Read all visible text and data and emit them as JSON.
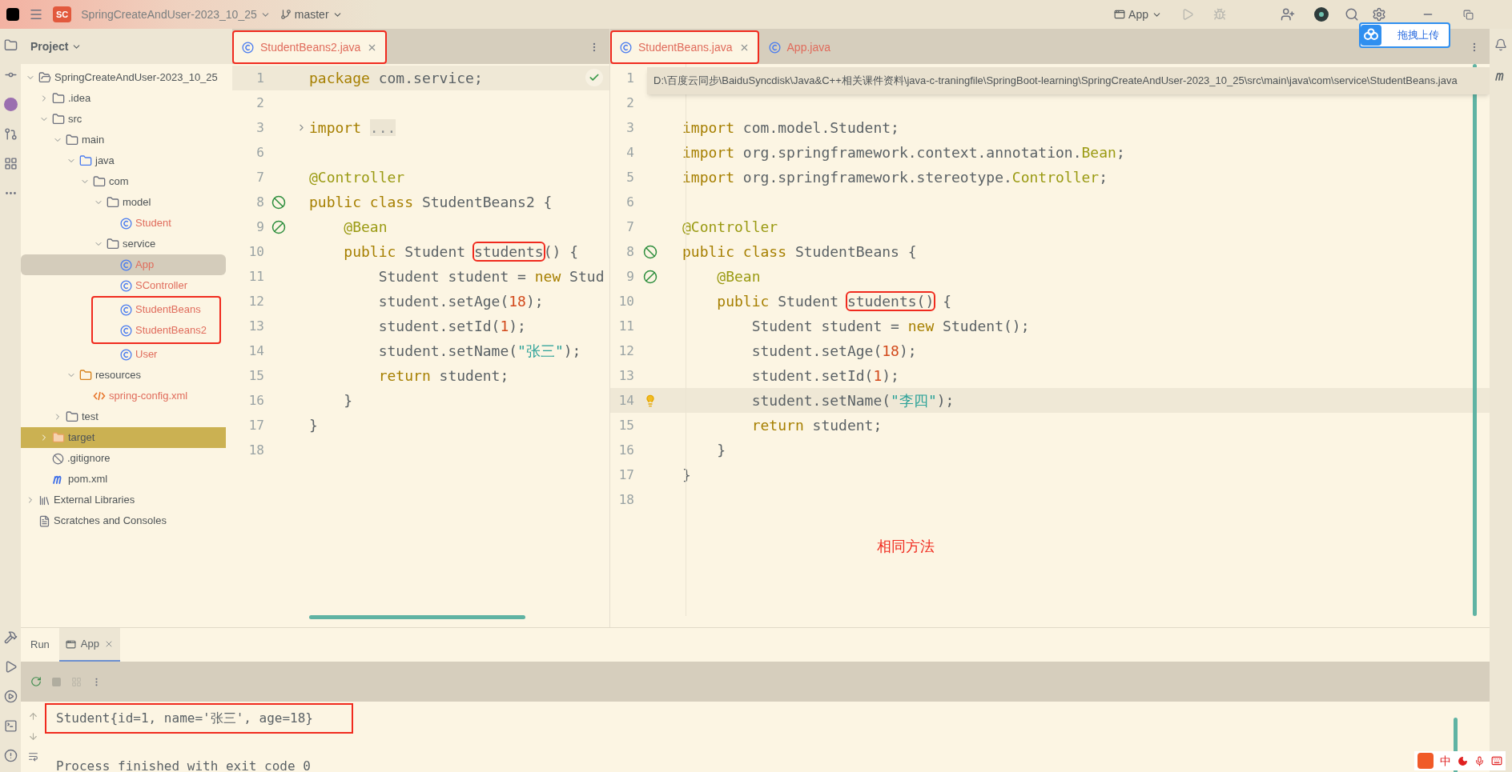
{
  "title_bar": {
    "project_badge": "SC",
    "project": "SpringCreateAndUser-2023_10_25",
    "branch": "master",
    "run_config": "App"
  },
  "upload_button": {
    "label": "拖拽上传"
  },
  "project_panel": {
    "title": "Project",
    "tree": [
      {
        "label": "SpringCreateAndUser-2023_10_25",
        "kind": "module",
        "expanded": true,
        "selected": false,
        "untracked": false,
        "boxed": false,
        "children": [
          {
            "label": ".idea",
            "kind": "folder",
            "expanded": false,
            "selected": false,
            "untracked": false,
            "boxed": false
          },
          {
            "label": "src",
            "kind": "folder",
            "expanded": true,
            "selected": false,
            "untracked": false,
            "boxed": false,
            "children": [
              {
                "label": "main",
                "kind": "folder",
                "expanded": true,
                "selected": false,
                "untracked": false,
                "boxed": false,
                "children": [
                  {
                    "label": "java",
                    "kind": "source",
                    "expanded": true,
                    "selected": false,
                    "untracked": false,
                    "boxed": false,
                    "children": [
                      {
                        "label": "com",
                        "kind": "package",
                        "expanded": true,
                        "selected": false,
                        "untracked": false,
                        "boxed": false,
                        "children": [
                          {
                            "label": "model",
                            "kind": "package",
                            "expanded": true,
                            "selected": false,
                            "untracked": false,
                            "boxed": false,
                            "children": [
                              {
                                "label": "Student",
                                "kind": "class",
                                "selected": false,
                                "untracked": true,
                                "boxed": false
                              }
                            ]
                          },
                          {
                            "label": "service",
                            "kind": "package",
                            "expanded": true,
                            "selected": false,
                            "untracked": false,
                            "boxed": false,
                            "children": [
                              {
                                "label": "App",
                                "kind": "class",
                                "selected": true,
                                "untracked": true,
                                "boxed": false
                              },
                              {
                                "label": "SController",
                                "kind": "class",
                                "selected": false,
                                "untracked": true,
                                "boxed": false
                              },
                              {
                                "label": "StudentBeans",
                                "kind": "class",
                                "selected": false,
                                "untracked": true,
                                "boxed": true
                              },
                              {
                                "label": "StudentBeans2",
                                "kind": "class",
                                "selected": false,
                                "untracked": true,
                                "boxed": true
                              },
                              {
                                "label": "User",
                                "kind": "class",
                                "selected": false,
                                "untracked": true,
                                "boxed": false
                              }
                            ]
                          }
                        ]
                      }
                    ]
                  },
                  {
                    "label": "resources",
                    "kind": "resources",
                    "expanded": true,
                    "selected": false,
                    "untracked": false,
                    "boxed": false,
                    "children": [
                      {
                        "label": "spring-config.xml",
                        "kind": "xml",
                        "selected": false,
                        "untracked": true,
                        "boxed": false
                      }
                    ]
                  }
                ]
              },
              {
                "label": "test",
                "kind": "folder",
                "expanded": false,
                "selected": false,
                "untracked": false,
                "boxed": false
              }
            ]
          },
          {
            "label": "target",
            "kind": "excluded",
            "expanded": false,
            "selected": false,
            "untracked": false,
            "boxed": false
          },
          {
            "label": ".gitignore",
            "kind": "ignore",
            "selected": false,
            "untracked": false,
            "boxed": false
          },
          {
            "label": "pom.xml",
            "kind": "maven",
            "selected": false,
            "untracked": false,
            "boxed": false
          }
        ]
      },
      {
        "label": "External Libraries",
        "kind": "libraries",
        "expanded": false,
        "selected": false,
        "untracked": false,
        "boxed": false
      },
      {
        "label": "Scratches and Consoles",
        "kind": "scratches",
        "selected": false,
        "untracked": false,
        "boxed": false
      }
    ]
  },
  "left_editor": {
    "tabs": [
      {
        "label": "StudentBeans2.java",
        "selected": true,
        "boxed": true
      }
    ],
    "inspection_ok": true,
    "lines": [
      {
        "number": "1",
        "current": true,
        "segments": [
          {
            "kind": "keyword",
            "text": "package"
          },
          {
            "kind": "plain",
            "text": " com.service;"
          }
        ]
      },
      {
        "number": "2",
        "current": false
      },
      {
        "number": "3",
        "current": false,
        "folded": true,
        "segments": [
          {
            "kind": "keyword",
            "text": "import "
          },
          {
            "kind": "fold",
            "text": "..."
          }
        ]
      },
      {
        "number": "6",
        "current": false
      },
      {
        "number": "7",
        "current": false,
        "segments": [
          {
            "kind": "annotation",
            "text": "@Controller"
          }
        ]
      },
      {
        "number": "8",
        "current": false,
        "marker": {
          "kind": "bean-class"
        },
        "segments": [
          {
            "kind": "keyword",
            "text": "public class"
          },
          {
            "kind": "plain",
            "text": " StudentBeans2 {"
          }
        ]
      },
      {
        "number": "9",
        "current": false,
        "marker": {
          "kind": "bean-method"
        },
        "segments": [
          {
            "kind": "annotation",
            "text": "    @Bean"
          }
        ]
      },
      {
        "number": "10",
        "current": false,
        "segments": [
          {
            "kind": "keyword",
            "text": "    public"
          },
          {
            "kind": "plain",
            "text": " Student "
          },
          {
            "kind": "plain",
            "text": "students",
            "boxed": true
          },
          {
            "kind": "plain",
            "text": "() {"
          }
        ]
      },
      {
        "number": "11",
        "current": false,
        "segments": [
          {
            "kind": "plain",
            "text": "        Student student = "
          },
          {
            "kind": "keyword",
            "text": "new"
          },
          {
            "kind": "plain",
            "text": " Stud"
          }
        ]
      },
      {
        "number": "12",
        "current": false,
        "segments": [
          {
            "kind": "plain",
            "text": "        student.setAge("
          },
          {
            "kind": "number",
            "text": "18"
          },
          {
            "kind": "plain",
            "text": ");"
          }
        ]
      },
      {
        "number": "13",
        "current": false,
        "segments": [
          {
            "kind": "plain",
            "text": "        student.setId("
          },
          {
            "kind": "number",
            "text": "1"
          },
          {
            "kind": "plain",
            "text": ");"
          }
        ]
      },
      {
        "number": "14",
        "current": false,
        "segments": [
          {
            "kind": "plain",
            "text": "        student.setName("
          },
          {
            "kind": "string",
            "text": "\"张三\""
          },
          {
            "kind": "plain",
            "text": ");"
          }
        ]
      },
      {
        "number": "15",
        "current": false,
        "segments": [
          {
            "kind": "keyword",
            "text": "        return"
          },
          {
            "kind": "plain",
            "text": " student;"
          }
        ]
      },
      {
        "number": "16",
        "current": false,
        "segments": [
          {
            "kind": "plain",
            "text": "    }"
          }
        ]
      },
      {
        "number": "17",
        "current": false,
        "segments": [
          {
            "kind": "plain",
            "text": "}"
          }
        ]
      },
      {
        "number": "18",
        "current": false
      }
    ]
  },
  "right_editor": {
    "tabs": [
      {
        "label": "StudentBeans.java",
        "selected": true,
        "boxed": true
      },
      {
        "label": "App.java",
        "selected": false,
        "boxed": false
      }
    ],
    "path_tooltip": "D:\\百度云同步\\BaiduSyncdisk\\Java&C++相关课件资料\\java-c-traningfile\\SpringBoot-learning\\SpringCreateAndUser-2023_10_25\\src\\main\\java\\com\\service\\StudentBeans.java",
    "lines": [
      {
        "number": "1",
        "current": false
      },
      {
        "number": "2",
        "current": false
      },
      {
        "number": "3",
        "current": false,
        "segments": [
          {
            "kind": "keyword",
            "text": "import"
          },
          {
            "kind": "plain",
            "text": " com.model.Student;"
          }
        ]
      },
      {
        "number": "4",
        "current": false,
        "segments": [
          {
            "kind": "keyword",
            "text": "import"
          },
          {
            "kind": "plain",
            "text": " org.springframework.context.annotation."
          },
          {
            "kind": "annotation",
            "text": "Bean"
          },
          {
            "kind": "plain",
            "text": ";"
          }
        ]
      },
      {
        "number": "5",
        "current": false,
        "segments": [
          {
            "kind": "keyword",
            "text": "import"
          },
          {
            "kind": "plain",
            "text": " org.springframework.stereotype."
          },
          {
            "kind": "annotation",
            "text": "Controller"
          },
          {
            "kind": "plain",
            "text": ";"
          }
        ]
      },
      {
        "number": "6",
        "current": false
      },
      {
        "number": "7",
        "current": false,
        "segments": [
          {
            "kind": "annotation",
            "text": "@Controller"
          }
        ]
      },
      {
        "number": "8",
        "current": false,
        "marker": {
          "kind": "bean-class"
        },
        "segments": [
          {
            "kind": "keyword",
            "text": "public class"
          },
          {
            "kind": "plain",
            "text": " StudentBeans {"
          }
        ]
      },
      {
        "number": "9",
        "current": false,
        "marker": {
          "kind": "bean-method"
        },
        "segments": [
          {
            "kind": "annotation",
            "text": "    @Bean"
          }
        ]
      },
      {
        "number": "10",
        "current": false,
        "segments": [
          {
            "kind": "keyword",
            "text": "    public"
          },
          {
            "kind": "plain",
            "text": " Student "
          },
          {
            "kind": "plain",
            "text": "students()",
            "boxed": true
          },
          {
            "kind": "plain",
            "text": " {"
          }
        ]
      },
      {
        "number": "11",
        "current": false,
        "segments": [
          {
            "kind": "plain",
            "text": "        Student student = "
          },
          {
            "kind": "keyword",
            "text": "new"
          },
          {
            "kind": "plain",
            "text": " Student();"
          }
        ]
      },
      {
        "number": "12",
        "current": false,
        "segments": [
          {
            "kind": "plain",
            "text": "        student.setAge("
          },
          {
            "kind": "number",
            "text": "18"
          },
          {
            "kind": "plain",
            "text": ");"
          }
        ]
      },
      {
        "number": "13",
        "current": false,
        "segments": [
          {
            "kind": "plain",
            "text": "        student.setId("
          },
          {
            "kind": "number",
            "text": "1"
          },
          {
            "kind": "plain",
            "text": ");"
          }
        ]
      },
      {
        "number": "14",
        "current": true,
        "marker": {
          "kind": "bulb"
        },
        "segments": [
          {
            "kind": "plain",
            "text": "        student.setName("
          },
          {
            "kind": "string",
            "text": "\"李四\""
          },
          {
            "kind": "plain",
            "text": ");"
          }
        ]
      },
      {
        "number": "15",
        "current": false,
        "segments": [
          {
            "kind": "keyword",
            "text": "        return"
          },
          {
            "kind": "plain",
            "text": " student;"
          }
        ]
      },
      {
        "number": "16",
        "current": false,
        "segments": [
          {
            "kind": "plain",
            "text": "    }"
          }
        ]
      },
      {
        "number": "17",
        "current": false,
        "segments": [
          {
            "kind": "plain",
            "text": "}"
          }
        ]
      },
      {
        "number": "18",
        "current": false
      }
    ]
  },
  "annotation_note": "相同方法",
  "run_panel": {
    "title": "Run",
    "tabs": [
      {
        "label": "App",
        "selected": true
      }
    ],
    "output": [
      {
        "text": "Student{id=1, name='张三', age=18}",
        "boxed": true
      },
      {
        "text": "Process finished with exit code 0",
        "boxed": false
      }
    ]
  },
  "ime_bar": {
    "label": "中"
  }
}
